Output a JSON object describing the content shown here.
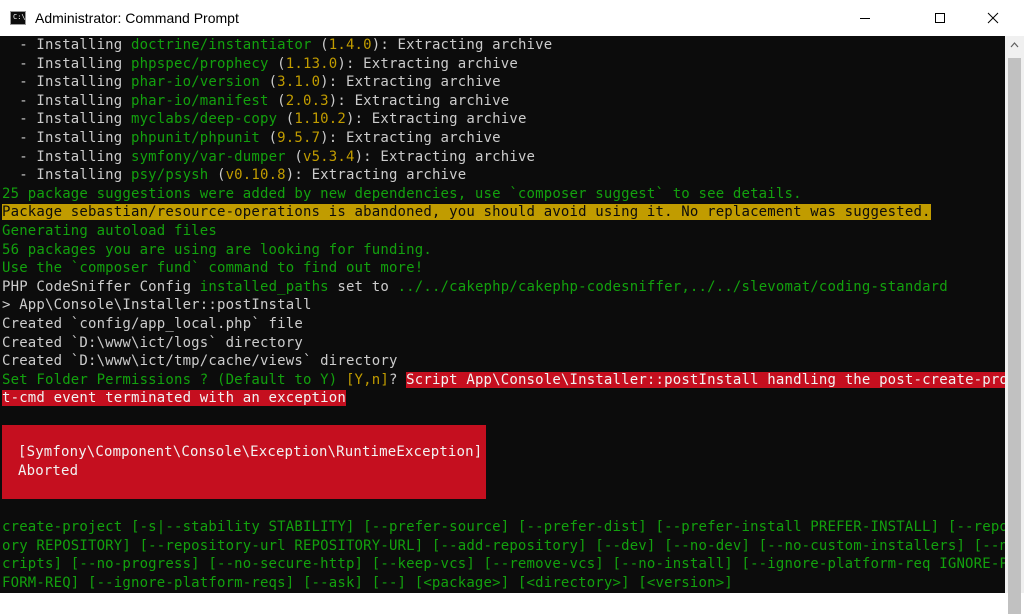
{
  "window": {
    "title": "Administrator: Command Prompt",
    "app_icon_text": "C:\\."
  },
  "console": {
    "installs": [
      {
        "prefix": "  - Installing ",
        "pkg": "doctrine/instantiator",
        "open": " (",
        "ver": "1.4.0",
        "close": "): Extracting archive"
      },
      {
        "prefix": "  - Installing ",
        "pkg": "phpspec/prophecy",
        "open": " (",
        "ver": "1.13.0",
        "close": "): Extracting archive"
      },
      {
        "prefix": "  - Installing ",
        "pkg": "phar-io/version",
        "open": " (",
        "ver": "3.1.0",
        "close": "): Extracting archive"
      },
      {
        "prefix": "  - Installing ",
        "pkg": "phar-io/manifest",
        "open": " (",
        "ver": "2.0.3",
        "close": "): Extracting archive"
      },
      {
        "prefix": "  - Installing ",
        "pkg": "myclabs/deep-copy",
        "open": " (",
        "ver": "1.10.2",
        "close": "): Extracting archive"
      },
      {
        "prefix": "  - Installing ",
        "pkg": "phpunit/phpunit",
        "open": " (",
        "ver": "9.5.7",
        "close": "): Extracting archive"
      },
      {
        "prefix": "  - Installing ",
        "pkg": "symfony/var-dumper",
        "open": " (",
        "ver": "v5.3.4",
        "close": "): Extracting archive"
      },
      {
        "prefix": "  - Installing ",
        "pkg": "psy/psysh",
        "open": " (",
        "ver": "v0.10.8",
        "close": "): Extracting archive"
      }
    ],
    "suggestions": "25 package suggestions were added by new dependencies, use `composer suggest` to see details.",
    "abandoned_warning": "Package sebastian/resource-operations is abandoned, you should avoid using it. No replacement was suggested.",
    "autoload": "Generating autoload files",
    "funding": "56 packages you are using are looking for funding.",
    "fund_hint": "Use the `composer fund` command to find out more!",
    "codesniffer": {
      "label": "PHP CodeSniffer Config ",
      "key": "installed_paths",
      "mid": " set to ",
      "value": "../../cakephp/cakephp-codesniffer,../../slevomat/coding-standard"
    },
    "post_install": "> App\\Console\\Installer::postInstall",
    "created_1": "Created `config/app_local.php` file",
    "created_2": "Created `D:\\www\\ict/logs` directory",
    "created_3": "Created `D:\\www\\ict/tmp/cache/views` directory",
    "permissions": {
      "question": "Set Folder Permissions ? (Default to Y) ",
      "options": "[Y,n]",
      "after": "? ",
      "error_part1": "Script App\\Console\\Installer::postInstall handling the post-create-projec",
      "error_part2": "t-cmd event terminated with an exception"
    },
    "exception": {
      "class": "[Symfony\\Component\\Console\\Exception\\RuntimeException]",
      "message": "Aborted"
    },
    "usage": [
      "create-project [-s|--stability STABILITY] [--prefer-source] [--prefer-dist] [--prefer-install PREFER-INSTALL] [--reposit",
      "ory REPOSITORY] [--repository-url REPOSITORY-URL] [--add-repository] [--dev] [--no-dev] [--no-custom-installers] [--no-s",
      "cripts] [--no-progress] [--no-secure-http] [--keep-vcs] [--remove-vcs] [--no-install] [--ignore-platform-req IGNORE-PLAT",
      "FORM-REQ] [--ignore-platform-reqs] [--ask] [--] [<package>] [<directory>] [<version>]"
    ]
  },
  "colors": {
    "background": "#0c0c0c",
    "default_text": "#cccccc",
    "green": "#13a10e",
    "yellow": "#c19c00",
    "error_red": "#c50f1f"
  }
}
